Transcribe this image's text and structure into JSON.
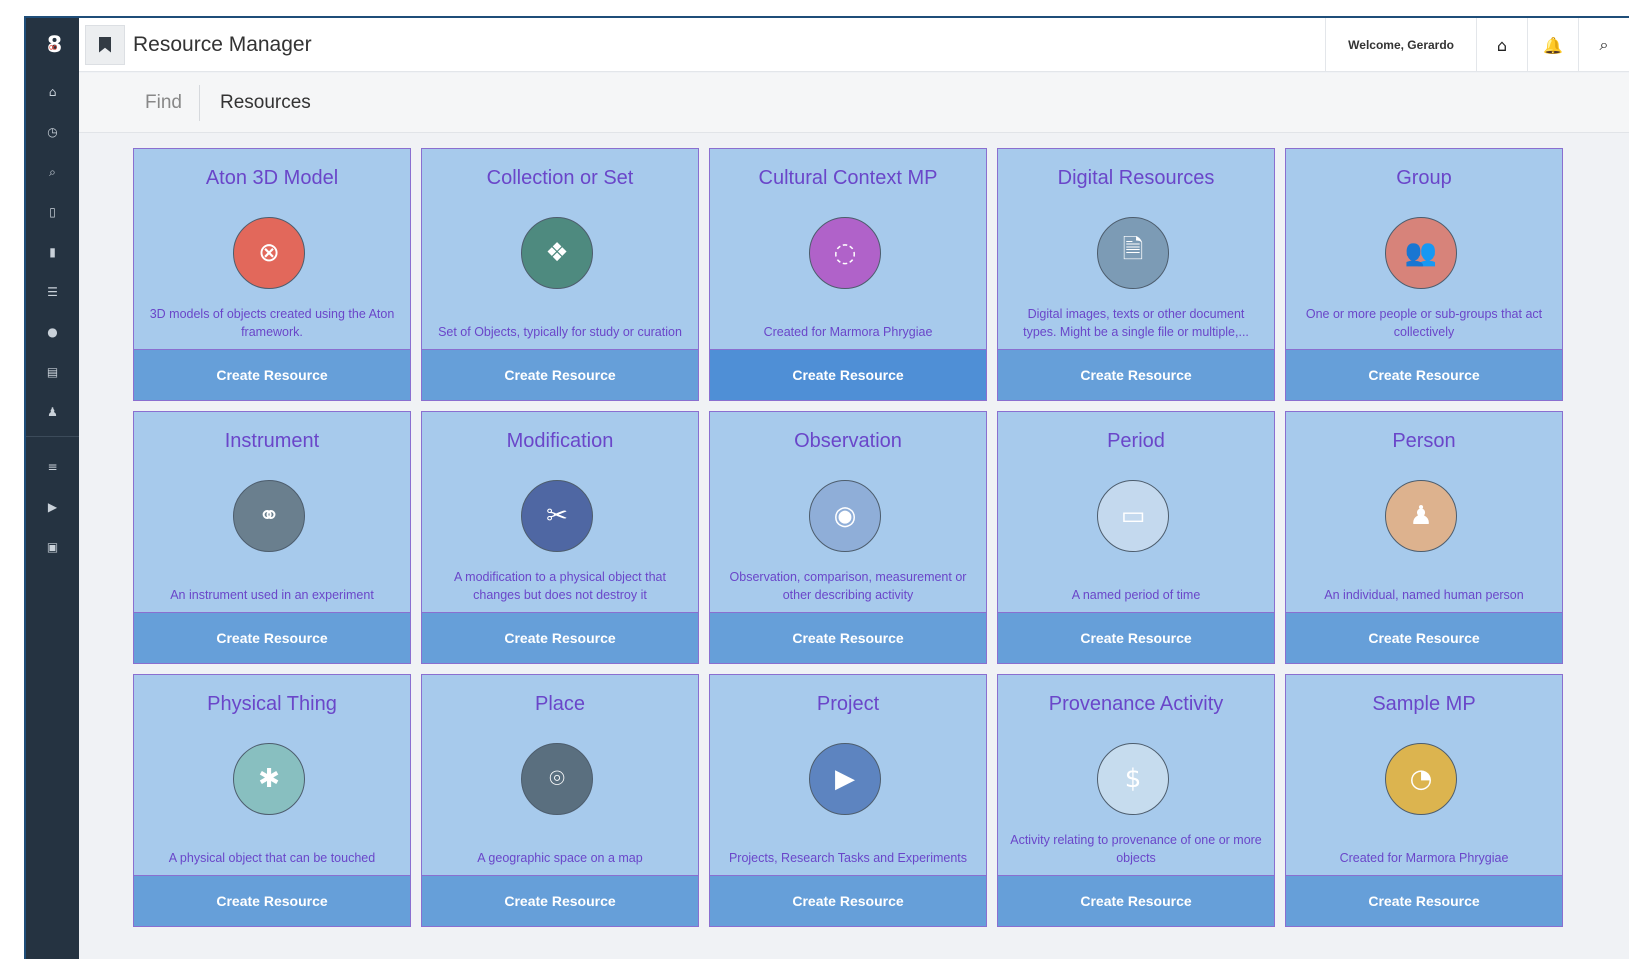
{
  "header": {
    "title": "Resource Manager",
    "welcome": "Welcome, Gerardo",
    "icons": [
      "home-icon",
      "bell-icon",
      "search-icon"
    ]
  },
  "sidebar": {
    "logo": "8",
    "items": [
      {
        "name": "home-icon",
        "glyph": "⌂"
      },
      {
        "name": "clock-icon",
        "glyph": "◷"
      },
      {
        "name": "search-icon",
        "glyph": "⌕"
      },
      {
        "name": "book-icon",
        "glyph": "▯"
      },
      {
        "name": "bookmark-icon",
        "glyph": "▮"
      },
      {
        "name": "list-icon",
        "glyph": "☰"
      },
      {
        "name": "globe-icon",
        "glyph": "●"
      },
      {
        "name": "file-icon",
        "glyph": "▤"
      },
      {
        "name": "user-icon",
        "glyph": "♟"
      },
      {
        "name": "align-left-icon",
        "glyph": "≡"
      },
      {
        "name": "play-circle-icon",
        "glyph": "▶"
      },
      {
        "name": "image-icon",
        "glyph": "▣"
      }
    ]
  },
  "subnav": {
    "find": "Find",
    "current": "Resources"
  },
  "cards": [
    {
      "title": "Aton 3D Model",
      "icon": "aton-icon",
      "glyph": "⊗",
      "color": "#e2685b",
      "description": "3D models of objects created using the Aton framework.",
      "button": "Create Resource"
    },
    {
      "title": "Collection or Set",
      "icon": "cubes-icon",
      "glyph": "❖",
      "color": "#4e8a7f",
      "description": "Set of Objects, typically for study or curation",
      "button": "Create Resource"
    },
    {
      "title": "Cultural Context MP",
      "icon": "circle-notch-icon",
      "glyph": "◌",
      "color": "#b062c9",
      "description": "Created for Marmora Phrygiae",
      "button": "Create Resource"
    },
    {
      "title": "Digital Resources",
      "icon": "document-icon",
      "glyph": "🗎",
      "color": "#7c9bb5",
      "description": "Digital images, texts or other document types. Might be a single file or multiple,...",
      "button": "Create Resource"
    },
    {
      "title": "Group",
      "icon": "users-icon",
      "glyph": "👥",
      "color": "#d7837a",
      "description": "One or more people or sub-groups that act collectively",
      "button": "Create Resource"
    },
    {
      "title": "Instrument",
      "icon": "binoculars-icon",
      "glyph": "⚭",
      "color": "#6a7f8e",
      "description": "An instrument used in an experiment",
      "button": "Create Resource"
    },
    {
      "title": "Modification",
      "icon": "scissors-icon",
      "glyph": "✂",
      "color": "#4f67a3",
      "description": "A modification to a physical object that changes but does not destroy it",
      "button": "Create Resource"
    },
    {
      "title": "Observation",
      "icon": "eye-icon",
      "glyph": "◉",
      "color": "#8faed8",
      "description": "Observation, comparison, measurement or other describing activity",
      "button": "Create Resource"
    },
    {
      "title": "Period",
      "icon": "calendar-icon",
      "glyph": "▭",
      "color": "#c4d9ee",
      "description": "A named period of time",
      "button": "Create Resource"
    },
    {
      "title": "Person",
      "icon": "user-icon",
      "glyph": "♟",
      "color": "#ddb28e",
      "description": "An individual, named human person",
      "button": "Create Resource"
    },
    {
      "title": "Physical Thing",
      "icon": "asterisk-icon",
      "glyph": "✱",
      "color": "#88bfc0",
      "description": "A physical object that can be touched",
      "button": "Create Resource"
    },
    {
      "title": "Place",
      "icon": "map-marker-icon",
      "glyph": "⌾",
      "color": "#5a6f7f",
      "description": "A geographic space on a map",
      "button": "Create Resource"
    },
    {
      "title": "Project",
      "icon": "video-play-icon",
      "glyph": "▶",
      "color": "#5d84c0",
      "description": "Projects, Research Tasks and Experiments",
      "button": "Create Resource"
    },
    {
      "title": "Provenance Activity",
      "icon": "dollar-icon",
      "glyph": "$",
      "color": "#c6dcee",
      "description": "Activity relating to provenance of one or more objects",
      "button": "Create Resource"
    },
    {
      "title": "Sample MP",
      "icon": "pie-chart-icon",
      "glyph": "◔",
      "color": "#dcb44f",
      "description": "Created for Marmora Phrygiae",
      "button": "Create Resource"
    }
  ]
}
